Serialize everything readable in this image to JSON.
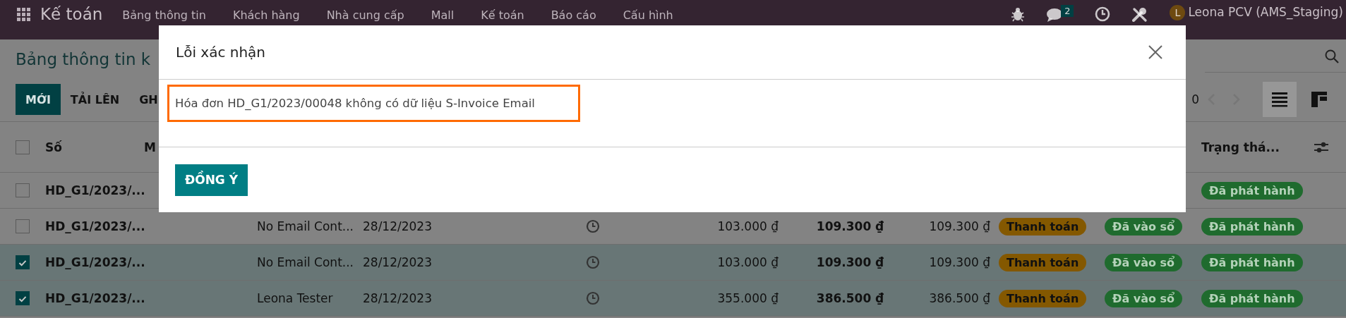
{
  "navbar": {
    "app_name": "Kế toán",
    "menus": [
      "Bảng thông tin",
      "Khách hàng",
      "Nhà cung cấp",
      "Mall",
      "Kế toán",
      "Báo cáo",
      "Cấu hình"
    ],
    "chat_count": "2",
    "avatar_letter": "L",
    "user": "Leona PCV (AMS_Staging)"
  },
  "control_panel": {
    "title": "Bảng thông tin k",
    "buttons": [
      {
        "label": "MỚI",
        "kind": "primary"
      },
      {
        "label": "TẢI LÊN",
        "kind": "secondary"
      },
      {
        "label": "GH",
        "kind": "secondary"
      }
    ],
    "pager": "0",
    "views": [
      {
        "kind": "list",
        "selected": true
      },
      {
        "kind": "kanban",
        "selected": false
      }
    ]
  },
  "table": {
    "all_selected": false,
    "columns": [
      "Số",
      "M",
      "Trạng thá..."
    ],
    "rows": [
      {
        "selected": false,
        "number": "HD_G1/2023/...",
        "status": "Đã phát hành"
      },
      {
        "selected": false,
        "number": "HD_G1/2023/...",
        "customer": "No Email Cont...",
        "date": "28/12/2023",
        "untaxed": "103.000 ₫",
        "total": "109.300 ₫",
        "due": "109.300 ₫",
        "payment": "Thanh toán",
        "posted": "Đã vào sổ",
        "status": "Đã phát hành"
      },
      {
        "selected": true,
        "number": "HD_G1/2023/...",
        "customer": "No Email Cont...",
        "date": "28/12/2023",
        "untaxed": "103.000 ₫",
        "total": "109.300 ₫",
        "due": "109.300 ₫",
        "payment": "Thanh toán",
        "posted": "Đã vào sổ",
        "status": "Đã phát hành"
      },
      {
        "selected": true,
        "number": "HD_G1/2023/...",
        "customer": "Leona Tester",
        "date": "28/12/2023",
        "untaxed": "355.000 ₫",
        "total": "386.500 ₫",
        "due": "386.500 ₫",
        "payment": "Thanh toán",
        "posted": "Đã vào sổ",
        "status": "Đã phát hành"
      }
    ]
  },
  "dialog": {
    "title": "Lỗi xác nhận",
    "message": "Hóa đơn HD_G1/2023/00048 không có dữ liệu S-Invoice Email",
    "button": "ĐỒNG Ý"
  }
}
